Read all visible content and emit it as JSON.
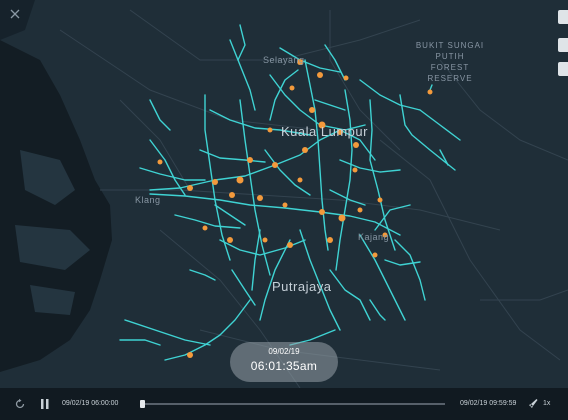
{
  "map": {
    "labels": {
      "selayang": "Selayang",
      "kuala_lumpur": "Kuala Lumpur",
      "klang": "Klang",
      "kajang": "Kajang",
      "putrajaya": "Putrajaya",
      "reserve": [
        "BUKIT SUNGAI",
        "PUTIH FOREST",
        "RESERVE"
      ]
    },
    "colors": {
      "land": "#1f2e38",
      "water": "#131d24",
      "roads": "#31404b",
      "trips": "#3fd3d3",
      "markers": "#f39a3c"
    }
  },
  "playback": {
    "date": "09/02/19",
    "time": "06:01:35am",
    "range_start": "09/02/19 06:00:00",
    "range_end": "09/02/19 09:59:59",
    "speed": "1x",
    "progress": 0.005
  },
  "icons": {
    "reset": "rotate-icon",
    "pause": "pause-icon",
    "speed": "rocket-icon"
  }
}
